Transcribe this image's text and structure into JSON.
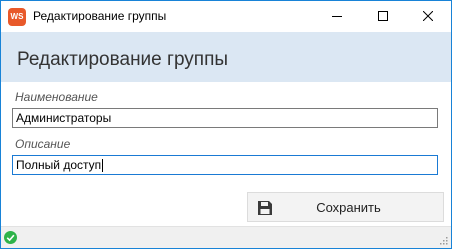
{
  "window": {
    "app_icon_text": "WS",
    "title": "Редактирование группы"
  },
  "header": {
    "title": "Редактирование группы"
  },
  "form": {
    "name_label": "Наименование",
    "name_value": "Администраторы",
    "description_label": "Описание",
    "description_value": "Полный доступ"
  },
  "actions": {
    "save_label": "Сохранить",
    "save_icon": "floppy-disk-icon"
  },
  "statusbar": {
    "status_icon": "check-circle-icon",
    "status_color": "#2eb34a"
  },
  "colors": {
    "accent": "#1883d7",
    "app_icon": "#e8592a",
    "header_band": "#dbe7f3"
  }
}
